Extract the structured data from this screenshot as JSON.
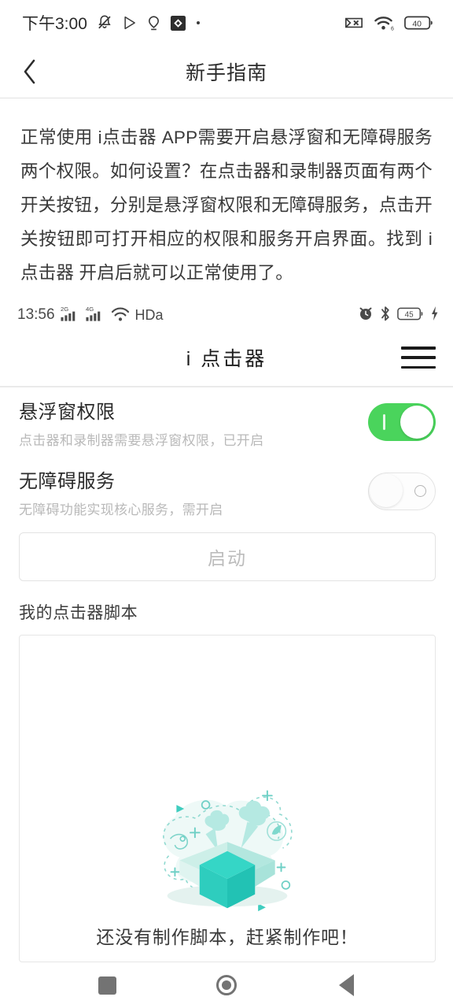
{
  "status_bar": {
    "time": "下午3:00",
    "left_icons": [
      "bell-mute-icon",
      "play-store-icon",
      "location-pin-icon",
      "app-badge-icon",
      "dot-icon"
    ],
    "right_icons": [
      "no-sim-icon",
      "wifi-icon",
      "battery-icon"
    ],
    "battery_level": "40"
  },
  "header": {
    "title": "新手指南",
    "back_icon": "chevron-left-icon"
  },
  "description": {
    "text": "正常使用 i点击器 APP需要开启悬浮窗和无障碍服务两个权限。如何设置？在点击器和录制器页面有两个开关按钮，分别是悬浮窗权限和无障碍服务，点击开关按钮即可打开相应的权限和服务开启界面。找到 i点击器 开启后就可以正常使用了。"
  },
  "embedded_screenshot": {
    "status_bar": {
      "time": "13:56",
      "network_labels": [
        "2G",
        "4G"
      ],
      "hd_label": "HDa",
      "right_icons": [
        "alarm-icon",
        "bluetooth-icon",
        "battery-icon",
        "charging-bolt-icon"
      ],
      "battery_level": "45"
    },
    "app_bar": {
      "title": "i 点击器",
      "menu_icon": "hamburger-menu-icon"
    },
    "permissions": [
      {
        "title": "悬浮窗权限",
        "subtitle": "点击器和录制器需要悬浮窗权限，已开启",
        "toggle_state": "on"
      },
      {
        "title": "无障碍服务",
        "subtitle": "无障碍功能实现核心服务，需开启",
        "toggle_state": "off"
      }
    ],
    "start_button": {
      "label": "启动",
      "enabled": false
    },
    "script_section": {
      "label": "我的点击器脚本",
      "empty_text": "还没有制作脚本，赶紧制作吧！",
      "illustration": "open-gift-box-illustration"
    }
  },
  "nav_bar": {
    "recents_icon": "square-recents-icon",
    "home_icon": "circle-home-icon",
    "back_icon": "triangle-back-icon"
  },
  "colors": {
    "toggle_on": "#4ad45c",
    "illustration_teal": "#2ecec0",
    "illustration_light": "#c9eee8",
    "text_primary": "#2b2b2b",
    "text_muted": "#b9b9b9",
    "border": "#e5e5e5"
  }
}
